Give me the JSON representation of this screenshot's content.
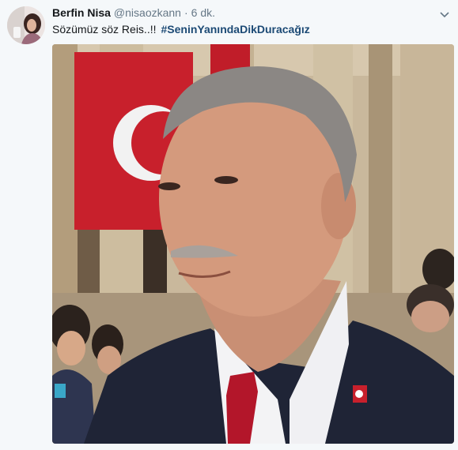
{
  "tweet": {
    "author_name": "Berfin Nisa",
    "handle": "@nisaozkann",
    "separator": "·",
    "time": "6 dk.",
    "text": "Sözümüz söz Reis..!!",
    "hashtag": "#SeninYanındaDikDuracağız"
  },
  "icons": {
    "menu": "chevron-down-icon"
  },
  "colors": {
    "background": "#f5f8fa",
    "hashtag": "#1c4a75",
    "muted": "#657786"
  }
}
